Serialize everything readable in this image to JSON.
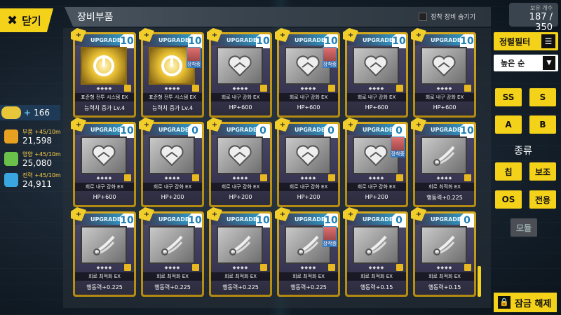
{
  "colors": {
    "accent": "#f5d21a",
    "upgrade": "#28b4e6",
    "card_border": "#d4a81f"
  },
  "close_button": {
    "label": "닫기",
    "icon": "close-icon"
  },
  "header": {
    "title": "장비부품",
    "hide_equipped_label": "장착 장비 숨기기"
  },
  "capacity": {
    "label": "보유 개수",
    "value": "187 / 350"
  },
  "commander": {
    "level": "166"
  },
  "resources": [
    {
      "name": "부품",
      "rate": "+45/10m",
      "value": "21,598",
      "color": "#e8a020"
    },
    {
      "name": "영양",
      "rate": "+45/10m",
      "value": "25,080",
      "color": "#6ac24a"
    },
    {
      "name": "전력",
      "rate": "+45/10m",
      "value": "24,911",
      "color": "#3aa6e0"
    }
  ],
  "sort_filter": {
    "label": "정렬필터"
  },
  "order": {
    "label": "높은 순"
  },
  "rank_buttons": [
    "SS",
    "S",
    "A",
    "B"
  ],
  "kind_title": "종류",
  "kind_buttons": [
    "칩",
    "보조",
    "OS",
    "전용",
    "모듈"
  ],
  "unlock_button": {
    "label": "잠금 해제"
  },
  "cards": [
    {
      "level": "10",
      "name": "표준형 전투 시스템 EX",
      "stat": "능력치 증가 Lv.4",
      "art": "gold-power-icon",
      "equipped": false
    },
    {
      "level": "10",
      "name": "표준형 전투 시스템 EX",
      "stat": "능력치 증가 Lv.4",
      "art": "gold-power-icon",
      "equipped": true,
      "equip_label": "장착중"
    },
    {
      "level": "10",
      "name": "회로 내구 강화 EX",
      "stat": "HP+600",
      "art": "heart-icon",
      "equipped": false
    },
    {
      "level": "10",
      "name": "회로 내구 강화 EX",
      "stat": "HP+600",
      "art": "heart-icon",
      "equipped": true,
      "equip_label": "장착중"
    },
    {
      "level": "10",
      "name": "회로 내구 강화 EX",
      "stat": "HP+600",
      "art": "heart-icon",
      "equipped": false
    },
    {
      "level": "10",
      "name": "회로 내구 강화 EX",
      "stat": "HP+600",
      "art": "heart-icon",
      "equipped": false
    },
    {
      "level": "10",
      "name": "회로 내구 강화 EX",
      "stat": "HP+600",
      "art": "heart-icon",
      "equipped": false
    },
    {
      "level": "0",
      "name": "회로 내구 강화 EX",
      "stat": "HP+200",
      "art": "heart-icon",
      "equipped": false
    },
    {
      "level": "0",
      "name": "회로 내구 강화 EX",
      "stat": "HP+200",
      "art": "heart-icon",
      "equipped": false
    },
    {
      "level": "0",
      "name": "회로 내구 강화 EX",
      "stat": "HP+200",
      "art": "heart-icon",
      "equipped": false
    },
    {
      "level": "0",
      "name": "회로 내구 강화 EX",
      "stat": "HP+200",
      "art": "heart-icon",
      "equipped": true,
      "equip_label": "장착중"
    },
    {
      "level": "10",
      "name": "회로 최적화 EX",
      "stat": "행동력+0.225",
      "art": "speed-icon",
      "equipped": false
    },
    {
      "level": "10",
      "name": "회로 최적화 EX",
      "stat": "행동력+0.225",
      "art": "speed-icon",
      "equipped": false
    },
    {
      "level": "10",
      "name": "회로 최적화 EX",
      "stat": "행동력+0.225",
      "art": "speed-icon",
      "equipped": false
    },
    {
      "level": "10",
      "name": "회로 최적화 EX",
      "stat": "행동력+0.225",
      "art": "speed-icon",
      "equipped": false
    },
    {
      "level": "10",
      "name": "회로 최적화 EX",
      "stat": "행동력+0.225",
      "art": "speed-icon",
      "equipped": true,
      "equip_label": "장착중"
    },
    {
      "level": "0",
      "name": "회로 최적화 EX",
      "stat": "행동력+0.15",
      "art": "speed-icon",
      "equipped": false
    },
    {
      "level": "0",
      "name": "회로 최적화 EX",
      "stat": "행동력+0.15",
      "art": "speed-icon",
      "equipped": false
    }
  ],
  "card_common": {
    "upgrade_label": "UPGRADE",
    "plus_label": "+",
    "dots": "◆◆◆◆"
  }
}
